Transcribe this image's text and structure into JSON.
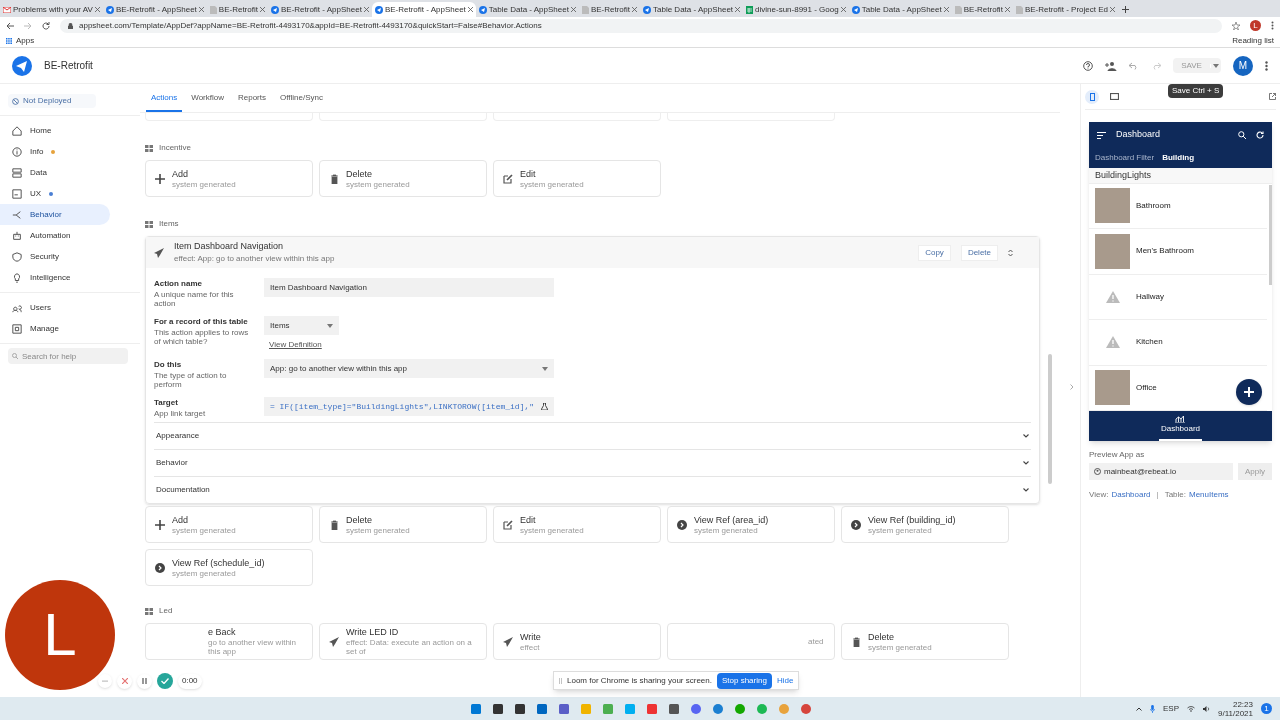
{
  "browser": {
    "tabs": [
      {
        "title": "Problems with your AV",
        "selected": false,
        "kind": "mail"
      },
      {
        "title": "BE-Retrofit - AppSheet",
        "selected": false,
        "kind": "appsheet"
      },
      {
        "title": "BE-Retrofit",
        "selected": false,
        "kind": "page"
      },
      {
        "title": "BE-Retrofit - AppSheet",
        "selected": false,
        "kind": "appsheet"
      },
      {
        "title": "BE-Retrofit - AppSheet",
        "selected": true,
        "kind": "appsheet"
      },
      {
        "title": "Table Data - AppSheet",
        "selected": false,
        "kind": "appsheet"
      },
      {
        "title": "BE-Retrofit",
        "selected": false,
        "kind": "page"
      },
      {
        "title": "Table Data - AppSheet",
        "selected": false,
        "kind": "appsheet"
      },
      {
        "title": "divine-sun-8991 - Goog",
        "selected": false,
        "kind": "sheet"
      },
      {
        "title": "Table Data - AppSheet",
        "selected": false,
        "kind": "appsheet"
      },
      {
        "title": "BE-Retrofit",
        "selected": false,
        "kind": "page"
      },
      {
        "title": "BE-Retrofit - Project Ed",
        "selected": false,
        "kind": "page"
      }
    ],
    "url": "appsheet.com/Template/AppDef?appName=BE-Retrofit-4493170&appId=BE-Retrofit-4493170&quickStart=False#Behavior.Actions",
    "profile": "L",
    "bookmark": "Apps",
    "reading_list": "Reading list"
  },
  "app": {
    "name": "BE-Retrofit",
    "save_button": {
      "label": "SAVE",
      "disabled": true
    },
    "avatar": "M",
    "tooltip": "Save Ctrl + S"
  },
  "sidebar": {
    "status": "Not Deployed",
    "items": [
      {
        "label": "Home",
        "selected": false
      },
      {
        "label": "Info",
        "selected": false,
        "color": "#e6a23c"
      },
      {
        "label": "Data",
        "selected": false
      },
      {
        "label": "UX",
        "selected": false,
        "color": "#4a7fd4"
      },
      {
        "label": "Behavior",
        "selected": true
      },
      {
        "label": "Automation",
        "selected": false
      },
      {
        "label": "Security",
        "selected": false
      },
      {
        "label": "Intelligence",
        "selected": false
      }
    ],
    "admin_items": [
      {
        "label": "Users",
        "selected": false
      },
      {
        "label": "Manage",
        "selected": false
      }
    ],
    "search": {
      "placeholder": "Search for help"
    }
  },
  "main": {
    "tabs": [
      {
        "label": "Actions",
        "selected": true
      },
      {
        "label": "Workflow",
        "selected": false
      },
      {
        "label": "Reports",
        "selected": false
      },
      {
        "label": "Offline/Sync",
        "selected": false
      }
    ],
    "incentive": {
      "title": "Incentive",
      "cards": [
        {
          "kind": "plus",
          "title": "Add",
          "subtitle": "system generated"
        },
        {
          "kind": "trash",
          "title": "Delete",
          "subtitle": "system generated"
        },
        {
          "kind": "edit",
          "title": "Edit",
          "subtitle": "system generated"
        }
      ]
    },
    "items": {
      "title": "Items",
      "action": {
        "title": "Item Dashboard Navigation",
        "effect": "effect: App: go to another view within this app",
        "buttons": [
          "Copy",
          "Delete"
        ],
        "fields": [
          {
            "kind": "text",
            "label": "Action name",
            "hint": "A unique name for this action",
            "value": "Item Dashboard Navigation"
          },
          {
            "kind": "select",
            "label": "For a record of this table",
            "hint": "This action applies to rows of which table?",
            "value": "Items",
            "link": "View Definition"
          },
          {
            "kind": "wideselect",
            "label": "Do this",
            "hint": "The type of action to perform",
            "value": "App: go to another view within this app"
          },
          {
            "kind": "formula",
            "label": "Target",
            "hint": "App link target",
            "value": "= IF([item_type]=\"BuildingLights\",LINKTOROW([item_id],\""
          }
        ],
        "sections": [
          {
            "label": "Appearance",
            "expanded": false
          },
          {
            "label": "Behavior",
            "expanded": false
          },
          {
            "label": "Documentation",
            "expanded": false
          }
        ]
      },
      "cards": [
        {
          "kind": "plus",
          "title": "Add",
          "subtitle": "system generated"
        },
        {
          "kind": "trash",
          "title": "Delete",
          "subtitle": "system generated"
        },
        {
          "kind": "edit",
          "title": "Edit",
          "subtitle": "system generated"
        },
        {
          "kind": "arrow",
          "title": "View Ref (area_id)",
          "subtitle": "system generated"
        },
        {
          "kind": "arrow",
          "title": "View Ref (building_id)",
          "subtitle": "system generated"
        },
        {
          "kind": "arrow",
          "title": "View Ref (schedule_id)",
          "subtitle": "system generated"
        }
      ]
    },
    "led": {
      "title": "Led",
      "cards": [
        {
          "kind": "covered",
          "title": "e Back",
          "subtitle": "go to another view within this app"
        },
        {
          "kind": "send",
          "title": "Write LED ID",
          "subtitle": "effect: Data: execute an action on a set of"
        },
        {
          "kind": "send",
          "title": "Write",
          "subtitle": "effect"
        },
        {
          "kind": "covered",
          "subtitle": "ated"
        },
        {
          "kind": "trash",
          "title": "Delete",
          "subtitle": "system generated"
        }
      ]
    }
  },
  "preview": {
    "devices": [
      {
        "kind": "phone",
        "selected": true
      },
      {
        "kind": "tablet",
        "selected": false
      }
    ],
    "screen": {
      "title": "Dashboard",
      "tabs": [
        {
          "label": "Dashboard Filter",
          "selected": false
        },
        {
          "label": "Building",
          "selected": true
        }
      ],
      "group": "BuildingLights",
      "rows": [
        {
          "label": "Bathroom",
          "kind": "photo"
        },
        {
          "label": "Men's Bathroom",
          "kind": "photo"
        },
        {
          "label": "Hallway",
          "kind": "missing"
        },
        {
          "label": "Kitchen",
          "kind": "missing"
        },
        {
          "label": "Office",
          "kind": "photo"
        }
      ],
      "nav": "Dashboard"
    },
    "preview_as": "Preview App as",
    "email": "mainbeat@rebeat.io",
    "apply": {
      "label": "Apply",
      "disabled": true
    },
    "footer": {
      "view_label": "View:",
      "view": "Dashboard",
      "separator": "|",
      "table_label": "Table:",
      "table": "MenuItems"
    }
  },
  "loom": {
    "avatar": "L",
    "timer": "0:00",
    "message": "Loom for Chrome is sharing your screen.",
    "stop": "Stop sharing",
    "hide": "Hide"
  },
  "taskbar": {
    "language": "ESP",
    "time": "22:23",
    "date": "9/11/2021",
    "notifications": "1"
  }
}
